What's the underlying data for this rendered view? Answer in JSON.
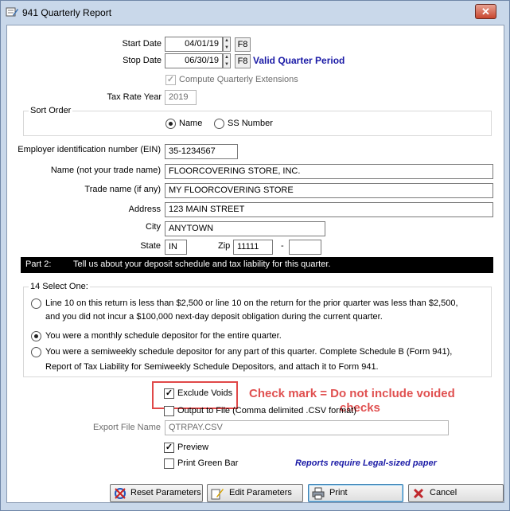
{
  "window": {
    "title": "941 Quarterly Report",
    "close_glyph": "✕"
  },
  "dates": {
    "start_label": "Start Date",
    "start_value": "04/01/19",
    "stop_label": "Stop Date",
    "stop_value": "06/30/19",
    "f8_label": "F8",
    "period_status": "Valid Quarter Period"
  },
  "options": {
    "compute_extensions_label": "Compute Quarterly Extensions",
    "tax_rate_year_label": "Tax Rate Year",
    "tax_rate_year_value": "2019"
  },
  "sort_order": {
    "caption": "Sort Order",
    "name_label": "Name",
    "ss_label": "SS Number"
  },
  "employer": {
    "ein_label": "Employer identification number (EIN)",
    "ein_value": "35-1234567",
    "name_label": "Name (not your trade name)",
    "name_value": "FLOORCOVERING STORE, INC.",
    "trade_label": "Trade name (if any)",
    "trade_value": "MY FLOORCOVERING STORE",
    "address_label": "Address",
    "address_value": "123 MAIN STREET",
    "city_label": "City",
    "city_value": "ANYTOWN",
    "state_label": "State",
    "state_value": "IN",
    "zip_label": "Zip",
    "zip_value": "11111",
    "zip_dash": "-",
    "zip_ext_value": ""
  },
  "part2": {
    "tag": "Part 2:",
    "text": "Tell us about your deposit schedule and tax liability for this quarter."
  },
  "select_one": {
    "caption": "14 Select One:",
    "opt1_line1": "Line 10 on this return is less than $2,500 or line 10 on the return for the prior quarter was less than $2,500,",
    "opt1_line2": "and you did not incur a $100,000 next-day deposit obligation during the current quarter.",
    "opt2_line1": "You were a monthly schedule depositor for the entire quarter.",
    "opt3_line1": "You were a semiweekly schedule depositor for any part of this quarter.  Complete Schedule B (Form 941),",
    "opt3_line2": "Report of Tax Liability for Semiweekly Schedule Depositors, and attach it to Form 941."
  },
  "output": {
    "exclude_voids_label": "Exclude Voids",
    "output_file_label": "Output to File (Comma delimited .CSV format)",
    "export_file_label": "Export File Name",
    "export_file_value": "QTRPAY.CSV",
    "preview_label": "Preview",
    "green_bar_label": "Print Green Bar",
    "legal_note": "Reports require Legal-sized paper"
  },
  "annotation": {
    "line1": "Check mark = Do not include voided",
    "line2": "checks"
  },
  "buttons": {
    "reset": "Reset Parameters",
    "edit": "Edit Parameters",
    "print": "Print",
    "cancel": "Cancel"
  },
  "check_glyph": "✓",
  "colors": {
    "window_frame": "#c9d8ea",
    "accent_blue": "#1a1aa6",
    "callout_red": "#e05050",
    "cancel_red": "#c0282d"
  }
}
